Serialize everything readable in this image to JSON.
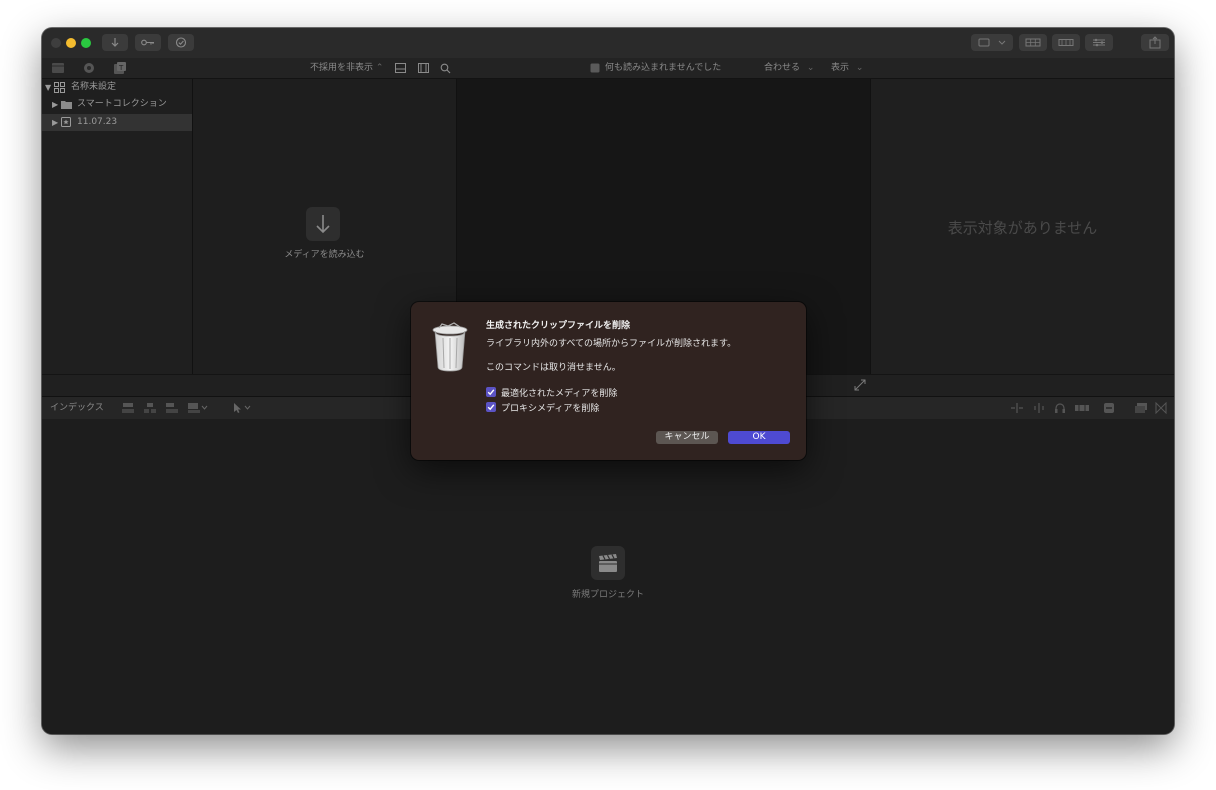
{
  "toolbar": {
    "import_icon": "download-icon",
    "keywords_icon": "key-icon",
    "background_tasks_icon": "checkmark-circle-icon"
  },
  "browser_bar": {
    "hide_rejected_label": "不採用を非表示",
    "viewer_status": "何も読み込まれませんでした",
    "fit_label": "合わせる",
    "view_label": "表示"
  },
  "sidebar": {
    "library_name": "名称未設定",
    "items": [
      {
        "label": "スマートコレクション"
      },
      {
        "label": "11.07.23"
      }
    ]
  },
  "browser": {
    "import_media_label": "メディアを読み込む"
  },
  "inspector": {
    "empty_label": "表示対象がありません"
  },
  "timeline": {
    "index_label": "インデックス",
    "new_project_label": "新規プロジェクト"
  },
  "dialog": {
    "title": "生成されたクリップファイルを削除",
    "message": "ライブラリ内外のすべての場所からファイルが削除されます。",
    "warning": "このコマンドは取り消せません。",
    "checkbox_optimized": {
      "label": "最適化されたメディアを削除",
      "checked": true
    },
    "checkbox_proxy": {
      "label": "プロキシメディアを削除",
      "checked": true
    },
    "cancel_label": "キャンセル",
    "ok_label": "OK"
  },
  "colors": {
    "accent": "#4e4ad2",
    "close": "#3e3e3e",
    "minimize": "#f4bc2f",
    "zoom": "#2ac840",
    "dialog_bg": "#302320"
  }
}
